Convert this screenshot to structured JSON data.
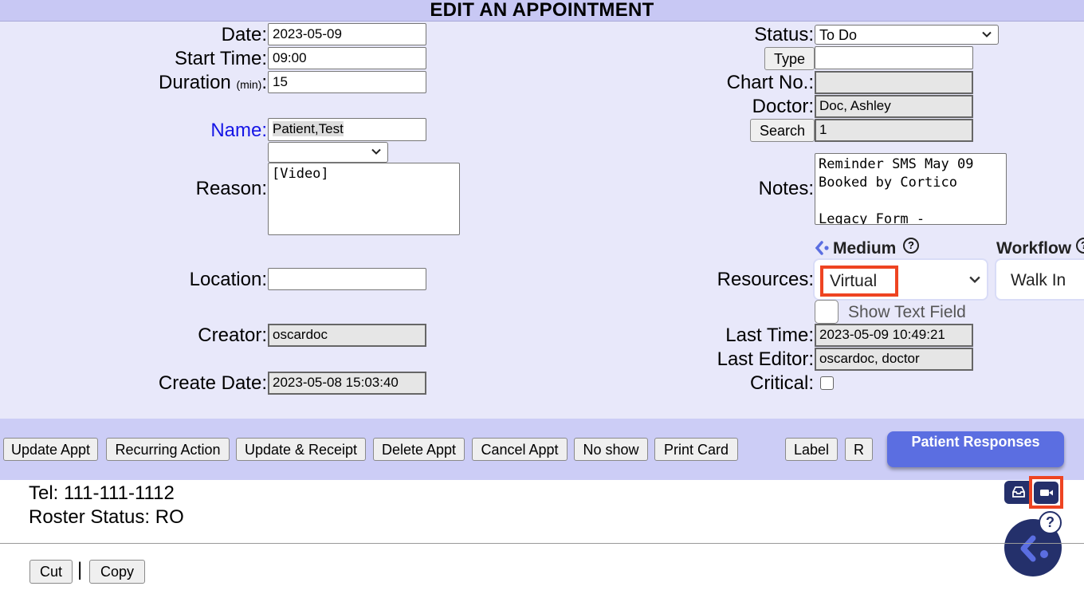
{
  "header": {
    "title": "EDIT AN APPOINTMENT"
  },
  "left": {
    "date_label": "Date:",
    "date_value": "2023-05-09",
    "start_label": "Start Time:",
    "start_value": "09:00",
    "duration_label": "Duration",
    "duration_unit": "(min)",
    "duration_colon": ":",
    "duration_value": "15",
    "name_label": "Name:",
    "name_value": "Patient,Test",
    "name_select_value": "",
    "reason_label": "Reason:",
    "reason_value": "[Video]",
    "location_label": "Location:",
    "location_value": "",
    "creator_label": "Creator:",
    "creator_value": "oscardoc",
    "create_date_label": "Create Date:",
    "create_date_value": "2023-05-08 15:03:40"
  },
  "right": {
    "status_label": "Status:",
    "status_value": "To Do",
    "type_button": "Type",
    "type_value": "",
    "chart_label": "Chart No.:",
    "chart_value": "",
    "doctor_label": "Doctor:",
    "doctor_value": "Doc, Ashley",
    "search_button": "Search",
    "search_value": "1",
    "notes_label": "Notes:",
    "notes_value": "Reminder SMS May 09\nBooked by Cortico\n\nLegacy Form -",
    "resources_label": "Resources:",
    "medium_title": "Medium",
    "medium_value": "Virtual",
    "workflow_title": "Workflow",
    "workflow_value": "Walk In",
    "show_text_field": "Show Text Field",
    "last_time_label": "Last Time:",
    "last_time_value": "2023-05-09 10:49:21",
    "last_editor_label": "Last Editor:",
    "last_editor_value": "oscardoc, doctor",
    "critical_label": "Critical:"
  },
  "buttons": {
    "update_appt": "Update Appt",
    "recurring": "Recurring Action",
    "update_receipt": "Update & Receipt",
    "delete_appt": "Delete Appt",
    "cancel_appt": "Cancel Appt",
    "no_show": "No show",
    "print_card": "Print Card",
    "label": "Label",
    "r": "R",
    "patient_responses": "Patient Responses"
  },
  "patient_info": {
    "tel": "Tel: 111-111-1112",
    "roster": "Roster Status: RO"
  },
  "footer": {
    "cut": "Cut",
    "separator": "|",
    "copy": "Copy"
  },
  "colors": {
    "accent": "#5b6ee1",
    "highlight": "#ee4422",
    "navy": "#24306b"
  },
  "icons": [
    "chevron-down-icon",
    "help-icon",
    "cortico-logo-icon",
    "inbox-icon",
    "video-camera-icon"
  ]
}
